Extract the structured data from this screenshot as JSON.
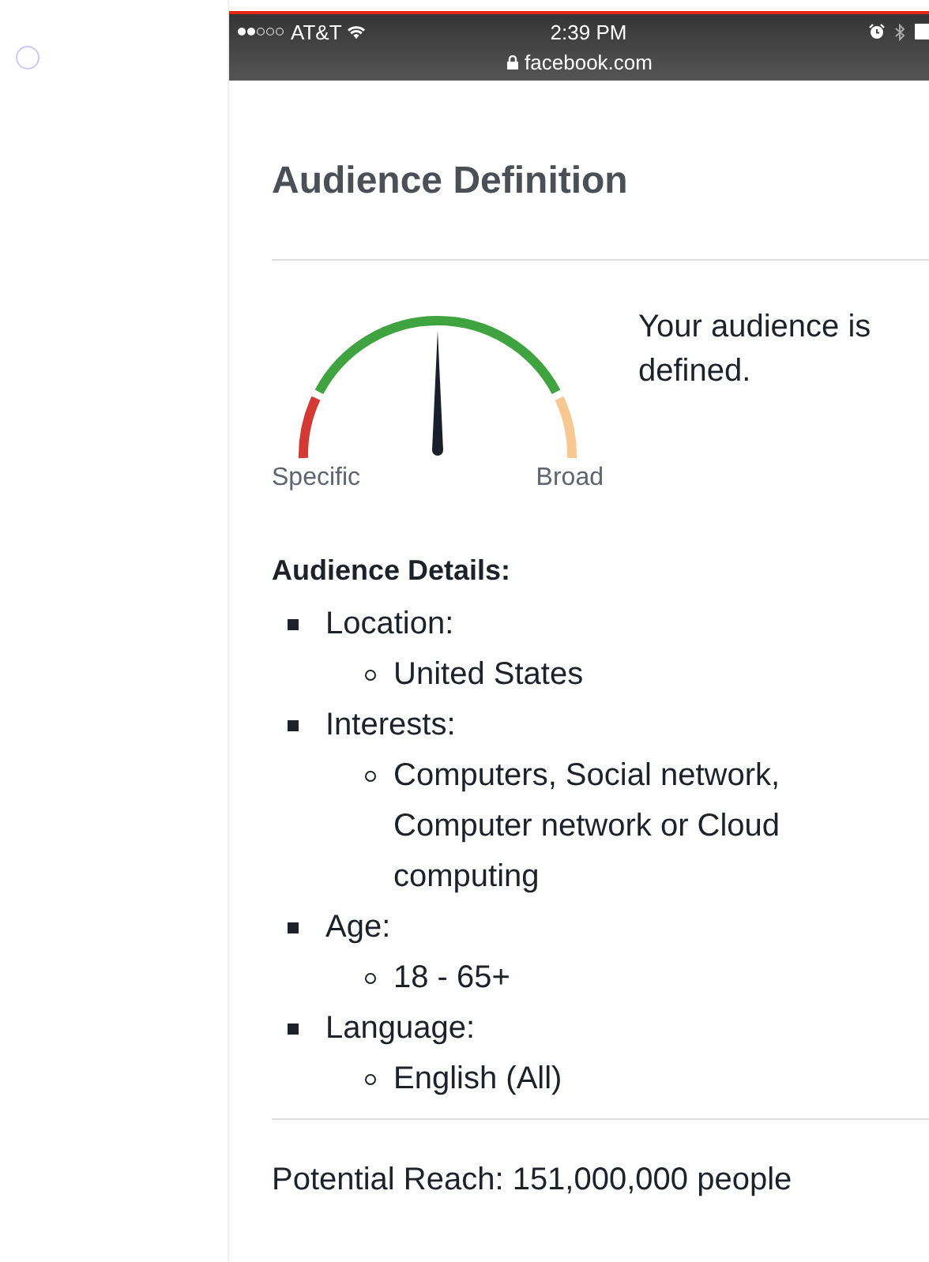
{
  "status_bar": {
    "carrier": "AT&T",
    "time": "2:39 PM",
    "url": "facebook.com"
  },
  "title": "Audience Definition",
  "gauge": {
    "min_label": "Specific",
    "max_label": "Broad"
  },
  "message": "Your audience is defined.",
  "details": {
    "heading": "Audience Details:",
    "items": [
      {
        "label": "Location:",
        "children": [
          {
            "label": "United States"
          }
        ]
      },
      {
        "label": "Interests:",
        "children": [
          {
            "label": "Computers, Social network, Computer network or Cloud computing"
          }
        ]
      },
      {
        "label": "Age:",
        "children": [
          {
            "label": "18 - 65+"
          }
        ]
      },
      {
        "label": "Language:",
        "children": [
          {
            "label": "English (All)"
          }
        ]
      }
    ]
  },
  "reach": "Potential Reach: 151,000,000 people"
}
